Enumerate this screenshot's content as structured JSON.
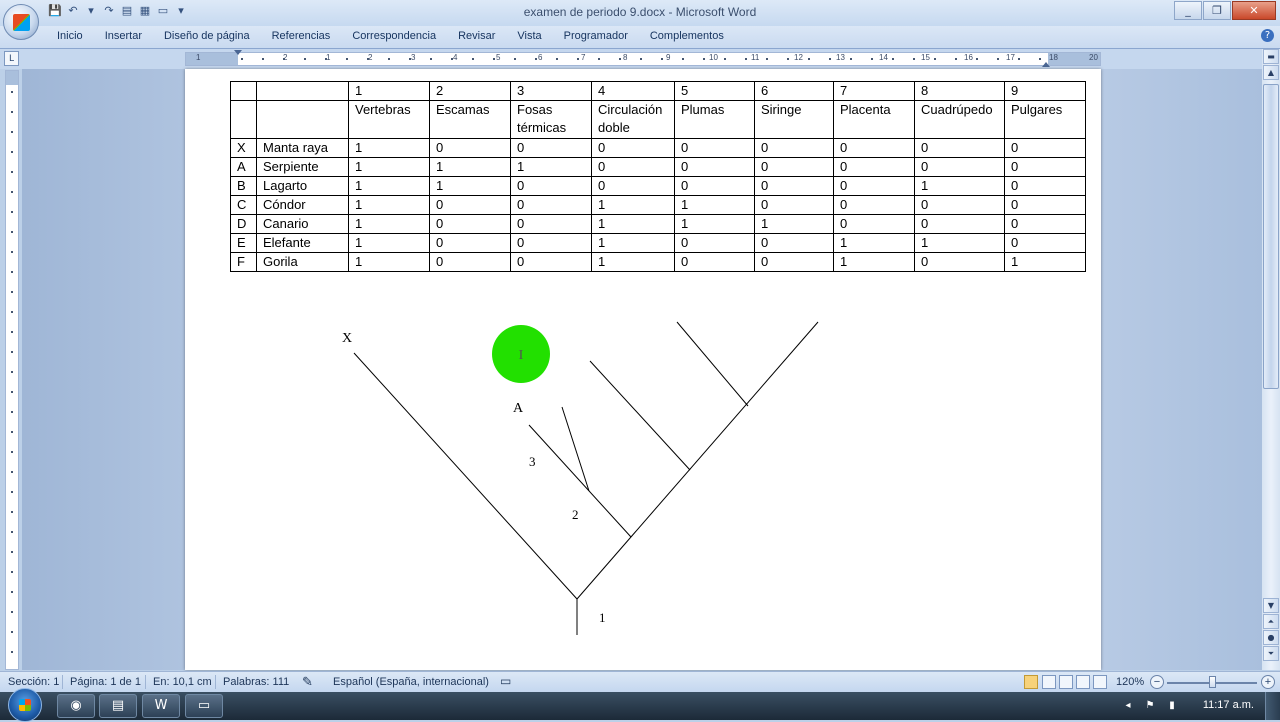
{
  "window": {
    "title": "examen de periodo 9.docx - Microsoft Word",
    "controls": [
      "_",
      "❐",
      "✕"
    ]
  },
  "ribbon": {
    "tabs": [
      "Inicio",
      "Insertar",
      "Diseño de página",
      "Referencias",
      "Correspondencia",
      "Revisar",
      "Vista",
      "Programador",
      "Complementos"
    ]
  },
  "ruler": {
    "numbers": [
      "1",
      "2",
      "1",
      "2",
      "3",
      "4",
      "5",
      "6",
      "7",
      "8",
      "9",
      "10",
      "11",
      "12",
      "13",
      "14",
      "15",
      "16",
      "17",
      "18",
      "20"
    ]
  },
  "table": {
    "header_numbers": [
      "",
      "",
      "1",
      "2",
      "3",
      "4",
      "5",
      "6",
      "7",
      "8",
      "9"
    ],
    "header_traits": [
      "",
      "",
      "Vertebras",
      "Escamas",
      "Fosas térmicas",
      "Circulación doble",
      "Plumas",
      "Siringe",
      "Placenta",
      "Cuadrúpedo",
      "Pulgares"
    ],
    "rows": [
      [
        "X",
        "Manta raya",
        "1",
        "0",
        "0",
        "0",
        "0",
        "0",
        "0",
        "0",
        "0"
      ],
      [
        "A",
        "Serpiente",
        "1",
        "1",
        "1",
        "0",
        "0",
        "0",
        "0",
        "0",
        "0"
      ],
      [
        "B",
        "Lagarto",
        "1",
        "1",
        "0",
        "0",
        "0",
        "0",
        "0",
        "1",
        "0"
      ],
      [
        "C",
        "Cóndor",
        "1",
        "0",
        "0",
        "1",
        "1",
        "0",
        "0",
        "0",
        "0"
      ],
      [
        "D",
        "Canario",
        "1",
        "0",
        "0",
        "1",
        "1",
        "1",
        "0",
        "0",
        "0"
      ],
      [
        "E",
        "Elefante",
        "1",
        "0",
        "0",
        "1",
        "0",
        "0",
        "1",
        "1",
        "0"
      ],
      [
        "F",
        "Gorila",
        "1",
        "0",
        "0",
        "1",
        "0",
        "0",
        "1",
        "0",
        "1"
      ]
    ]
  },
  "cladogram": {
    "labels": {
      "x": "X",
      "a": "A",
      "n3": "3",
      "n2": "2",
      "n1": "1"
    },
    "cursor_highlight_color": "#22e000"
  },
  "statusbar": {
    "section": "Sección: 1",
    "page": "Página: 1 de 1",
    "position": "En: 10,1 cm",
    "words": "Palabras: 111",
    "language": "Español (España, internacional)",
    "zoom": "120%"
  },
  "taskbar": {
    "clock": "11:17 a.m.",
    "apps": [
      "chrome",
      "explorer",
      "word",
      "folder"
    ]
  }
}
